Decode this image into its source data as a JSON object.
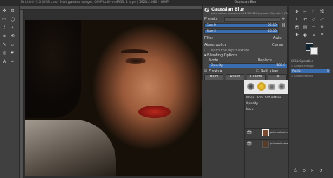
{
  "app": {
    "title": "[Untitled]-5.0 (RGB color 8-bit gamma integer, GIMP built-in sRGB, 1 layer) 1920x1080 – GIMP",
    "dialog_window_title": "Gaussian Blur"
  },
  "dialog": {
    "title": "Gaussian Blur",
    "subtitle": "paloma-kuzma-unsplash-1-1280x220.jpg-aaaa 55 photo-2 (Photo)",
    "presets_label": "Presets:",
    "size_x_label": "Size X",
    "size_x_value": "25.50",
    "size_y_label": "Size Y",
    "size_y_value": "25.50",
    "filter_label": "Filter",
    "filter_value": "Auto",
    "abyss_label": "Abyss policy",
    "abyss_value": "Clamp",
    "clip_label": "Clip to the input extent",
    "blending_label": "Blending Options",
    "mode_label": "Mode",
    "mode_value": "Replace",
    "opacity_label": "Opacity",
    "opacity_value": "100.0",
    "preview_label": "Preview",
    "split_label": "Split view",
    "help_btn": "Help",
    "reset_btn": "Reset",
    "cancel_btn": "Cancel",
    "ok_btn": "OK"
  },
  "right_panel": {
    "section_title": "GEGL Operation",
    "sample_average": "Sample average",
    "radius_label": "Radius",
    "radius_value": "3",
    "sample_merged": "Sample merged"
  },
  "layers": {
    "mode_label": "Mode",
    "mode_value": "HSV Saturation",
    "opacity_label": "Opacity",
    "lock_label": "Lock:",
    "layer1_name": "paloma-kuzma-unsplash",
    "layer2_name": "paloma-kuzma-unsplash"
  },
  "colors": {
    "accent_blue": "#3a6cb0",
    "lips_red": "#b8281c",
    "selection": "#d0b030"
  }
}
